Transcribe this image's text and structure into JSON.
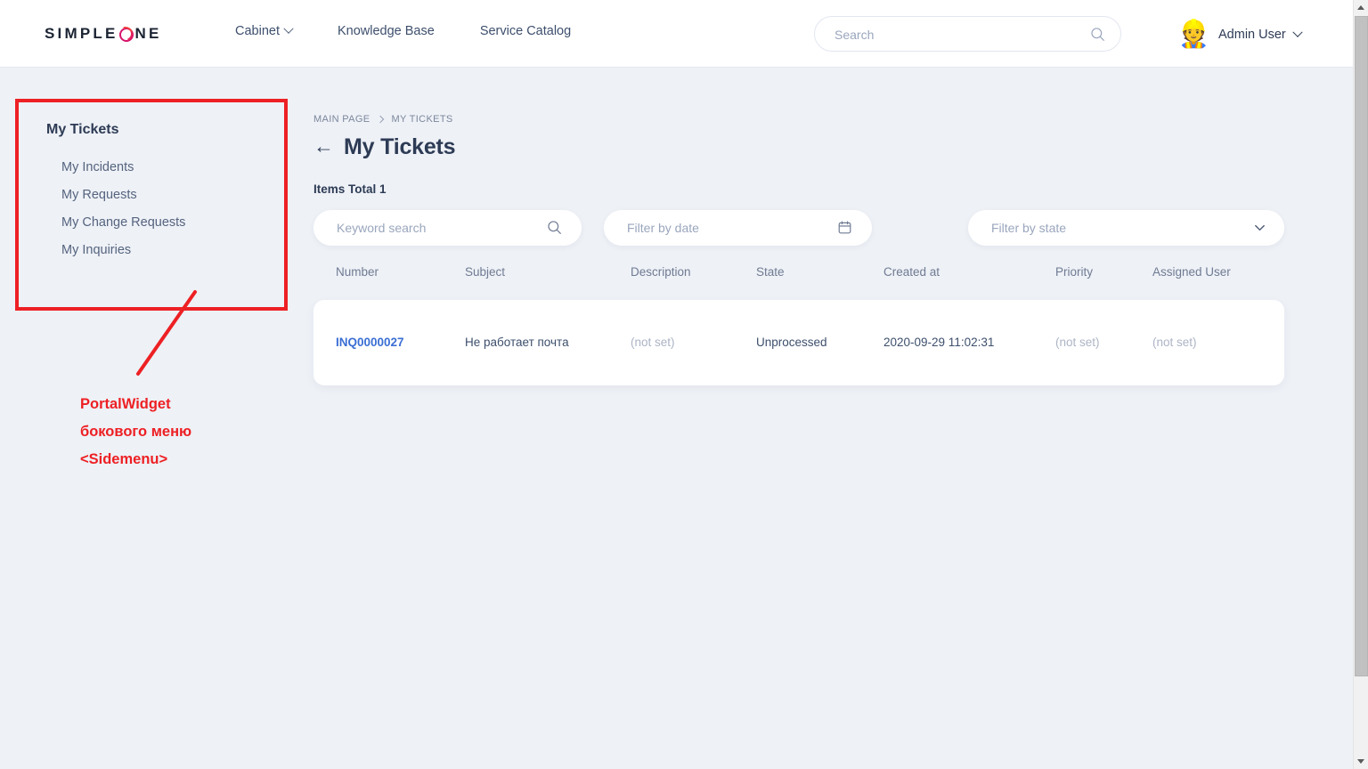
{
  "header": {
    "logo": {
      "prefix": "SIMPLE",
      "glyph": "ring-o",
      "suffix": "NE"
    },
    "nav": [
      {
        "label": "Cabinet",
        "has_dropdown": true
      },
      {
        "label": "Knowledge Base",
        "has_dropdown": false
      },
      {
        "label": "Service Catalog",
        "has_dropdown": false
      }
    ],
    "search": {
      "placeholder": "Search",
      "value": "",
      "icon": "search-icon"
    },
    "user": {
      "name": "Admin User",
      "avatar_emoji": "👷",
      "chevron": "chevron-down-icon"
    }
  },
  "sidebar": {
    "title": "My Tickets",
    "items": [
      {
        "label": "My Incidents"
      },
      {
        "label": "My Requests"
      },
      {
        "label": "My Change Requests"
      },
      {
        "label": "My Inquiries"
      }
    ]
  },
  "annotation": {
    "color": "#ed2024",
    "lines": [
      "PortalWidget",
      "бокового меню",
      "<Sidemenu>"
    ]
  },
  "main": {
    "breadcrumb": [
      {
        "label": "MAIN PAGE",
        "current": false
      },
      {
        "label": "MY TICKETS",
        "current": true
      }
    ],
    "back_arrow": "←",
    "title": "My Tickets",
    "items_total": "Items Total 1",
    "filters": [
      {
        "name": "keyword",
        "placeholder": "Keyword search",
        "value": "",
        "icon": "search-icon"
      },
      {
        "name": "date",
        "placeholder": "Filter by date",
        "value": "",
        "icon": "calendar-icon"
      },
      {
        "name": "state",
        "placeholder": "Filter by state",
        "value": "",
        "icon": "chevron-down-icon"
      }
    ],
    "table": {
      "columns": [
        "Number",
        "Subject",
        "Description",
        "State",
        "Created at",
        "Priority",
        "Assigned User"
      ],
      "rows": [
        {
          "number": "INQ0000027",
          "subject": "Не работает почта",
          "description": "(not set)",
          "state": "Unprocessed",
          "created_at": "2020-09-29 11:02:31",
          "priority": "(not set)",
          "assigned_user": "(not set)"
        }
      ]
    }
  }
}
